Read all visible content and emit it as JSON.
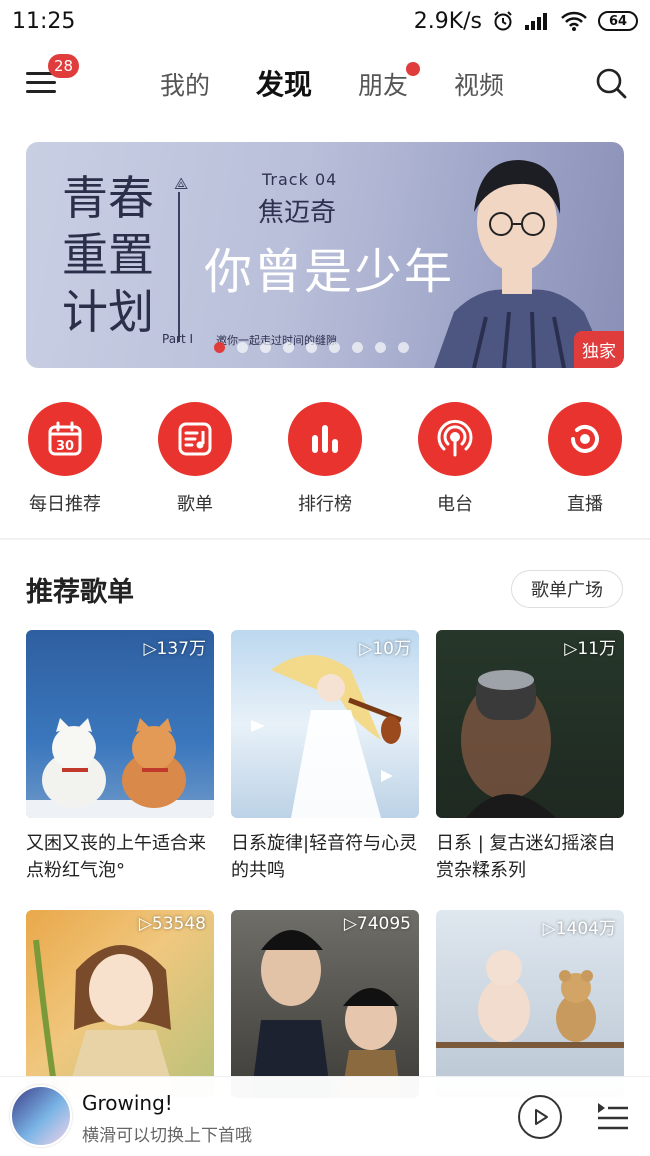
{
  "status_bar": {
    "time": "11:25",
    "net_speed": "2.9K/s",
    "battery": "64"
  },
  "header": {
    "menu_badge": "28",
    "tabs": [
      {
        "label": "我的"
      },
      {
        "label": "发现",
        "active": true
      },
      {
        "label": "朋友",
        "dot": true
      },
      {
        "label": "视频"
      }
    ]
  },
  "banner": {
    "left_lines": [
      "青春",
      "重置",
      "计划"
    ],
    "track": "Track  04",
    "artist": "焦迈奇",
    "song": "你曾是少年",
    "part": "Part I",
    "tagline": "邀你一起走过时间的缝隙",
    "badge": "独家",
    "dot_count": 9,
    "active_dot": 1
  },
  "quick_entries": [
    {
      "label": "每日推荐",
      "icon": "calendar-icon",
      "day": "30"
    },
    {
      "label": "歌单",
      "icon": "playlist-icon"
    },
    {
      "label": "排行榜",
      "icon": "chart-bars-icon"
    },
    {
      "label": "电台",
      "icon": "radio-icon"
    },
    {
      "label": "直播",
      "icon": "live-icon"
    }
  ],
  "section": {
    "title": "推荐歌单",
    "more_label": "歌单广场"
  },
  "playlists": [
    {
      "plays": "137万",
      "title": "又困又丧的上午适合来点粉红气泡°"
    },
    {
      "plays": "10万",
      "title": "日系旋律|轻音符与心灵的共鸣"
    },
    {
      "plays": "11万",
      "title": "日系 | 复古迷幻摇滚自赏杂糅系列"
    },
    {
      "plays": "53548",
      "title": ""
    },
    {
      "plays": "74095",
      "title": ""
    },
    {
      "plays": "1404万",
      "title": ""
    }
  ],
  "player": {
    "title": "Growing!",
    "subtitle": "横滑可以切换上下首哦"
  },
  "colors": {
    "accent": "#e8332e",
    "badge": "#e03c3c"
  }
}
